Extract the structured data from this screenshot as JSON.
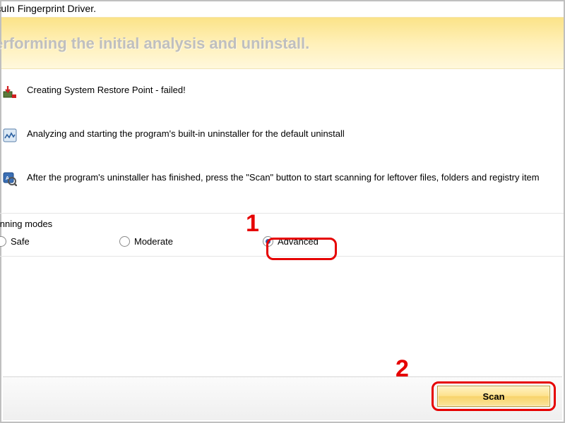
{
  "top_cut": "nstalling SecuIn Fingerprint Driver.",
  "banner": {
    "title": "erforming the initial analysis and uninstall."
  },
  "steps": {
    "restore": "Creating System Restore Point - failed!",
    "analyze": "Analyzing and starting the program's built-in uninstaller for the default uninstall",
    "scanhint": "After the program's uninstaller has finished, press the \"Scan\" button to start scanning for leftover files, folders and registry item"
  },
  "modes": {
    "label": "canning modes",
    "safe": "Safe",
    "moderate": "Moderate",
    "advanced": "Advanced"
  },
  "footer": {
    "scan_label": "Scan"
  },
  "annotations": {
    "num1": "1",
    "num2": "2"
  }
}
